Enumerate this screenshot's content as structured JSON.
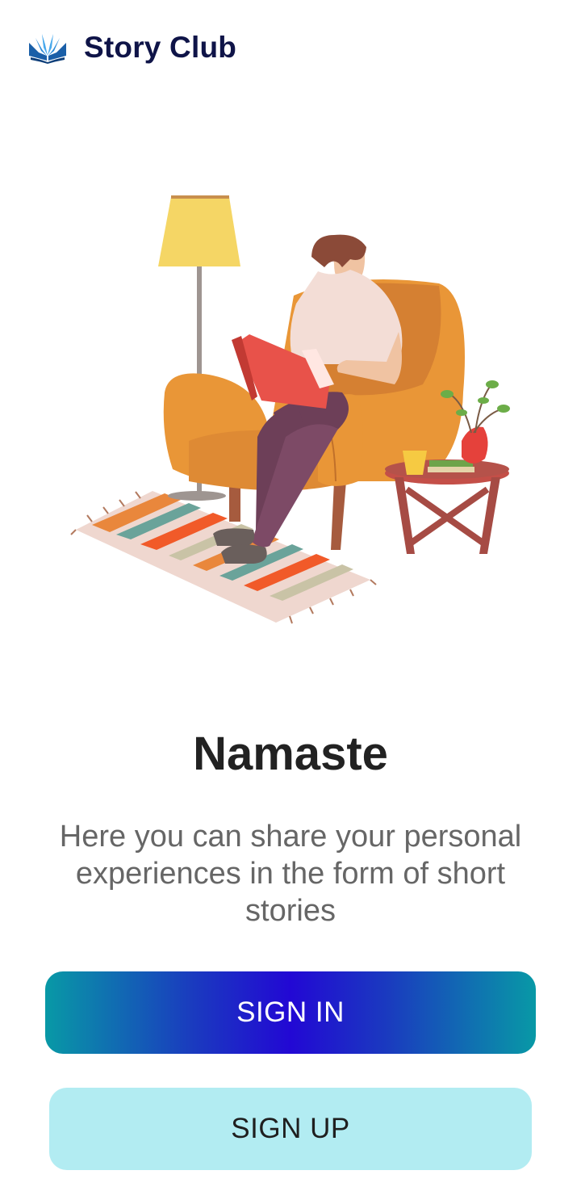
{
  "app": {
    "name": "Story Club",
    "logo_icon": "open-book-icon"
  },
  "hero": {
    "illustration": "person-reading-in-armchair-illustration"
  },
  "main": {
    "greeting": "Namaste",
    "tagline": "Here you can share your personal experiences in the form of short stories"
  },
  "actions": {
    "sign_in_label": "SIGN IN",
    "sign_up_label": "SIGN UP"
  },
  "colors": {
    "brand_text": "#0f1448",
    "sign_in_gradient": [
      "#0899a6",
      "#2208d4",
      "#0899a6"
    ],
    "sign_up_bg": "#b2ecf2"
  }
}
